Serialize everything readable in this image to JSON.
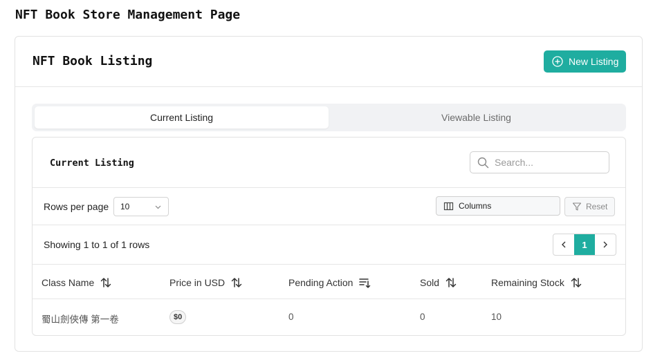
{
  "page": {
    "title": "NFT Book Store Management Page"
  },
  "listing": {
    "title": "NFT Book Listing",
    "new_button": "New Listing",
    "tabs": [
      {
        "label": "Current Listing",
        "active": true
      },
      {
        "label": "Viewable Listing",
        "active": false
      }
    ]
  },
  "table_panel": {
    "title": "Current Listing",
    "search_placeholder": "Search...",
    "rows_per_page_label": "Rows per page",
    "rows_per_page_value": "10",
    "columns_button": "Columns",
    "reset_button": "Reset",
    "showing_text": "Showing 1 to 1 of 1 rows",
    "current_page": "1",
    "columns": [
      "Class Name",
      "Price in USD",
      "Pending Action",
      "Sold",
      "Remaining Stock"
    ],
    "rows": [
      {
        "class_name": "蜀山劍俠傳 第一卷",
        "price": "$0",
        "pending_action": "0",
        "sold": "0",
        "remaining_stock": "10"
      }
    ]
  },
  "colors": {
    "accent": "#1fada0",
    "border": "#e2e2e2",
    "tab_bg": "#f1f2f4"
  }
}
